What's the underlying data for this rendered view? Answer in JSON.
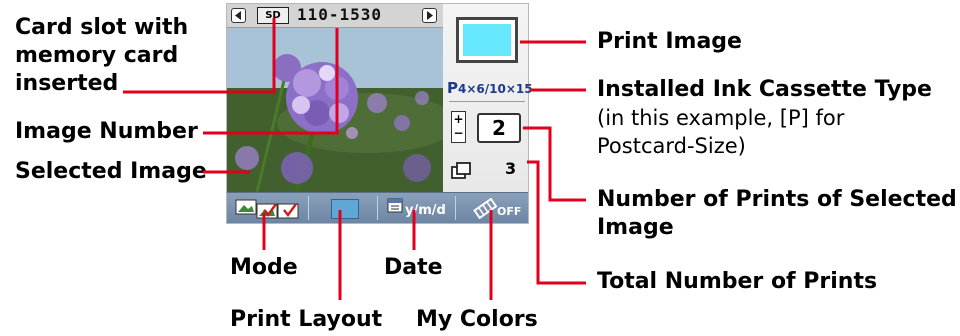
{
  "callouts": {
    "card_slot": "Card slot with\nmemory card\ninserted",
    "image_number": "Image Number",
    "selected_image": "Selected Image",
    "mode": "Mode",
    "date": "Date",
    "print_layout": "Print Layout",
    "my_colors": "My Colors",
    "print_image": "Print Image",
    "ink_cassette": "Installed Ink Cassette Type",
    "ink_cassette_note": "(in this example, [P] for\nPostcard-Size)",
    "prints_selected": "Number of Prints of Selected\nImage",
    "total_prints": "Total Number of Prints"
  },
  "screen": {
    "sd_label": "SD",
    "image_number": "110-1530",
    "cassette_prefix": "P",
    "cassette_size": "4×6/10×15",
    "print_count": "2",
    "total_count": "3",
    "plus_minus": "+\n−",
    "date_format": "y/m/d",
    "my_colors_state": "OFF"
  },
  "colors": {
    "callout_line": "#e0001b",
    "print_image_fill": "#66e8ff",
    "bottombar": "#7a92b0",
    "cassette_text": "#1b3a8a"
  },
  "icons": [
    "left-arrow-icon",
    "right-arrow-icon",
    "sd-card-icon",
    "mode-icon",
    "print-layout-icon",
    "date-icon",
    "my-colors-icon",
    "total-prints-icon"
  ]
}
